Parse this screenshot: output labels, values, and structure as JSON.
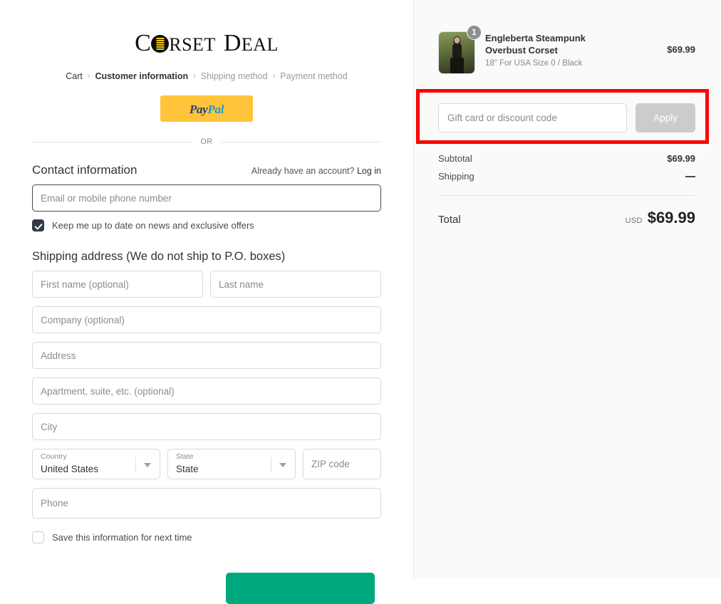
{
  "brand": {
    "logo_text_1": "C",
    "logo_o": "corset-lacing-o",
    "logo_text_2": "RSET",
    "logo_text_3": "D",
    "logo_text_4": "EAL",
    "logo_full": "CORSET DEAL"
  },
  "breadcrumb": {
    "items": [
      {
        "label": "Cart",
        "state": "link"
      },
      {
        "label": "Customer information",
        "state": "active"
      },
      {
        "label": "Shipping method",
        "state": "muted"
      },
      {
        "label": "Payment method",
        "state": "muted"
      }
    ],
    "separator": "›"
  },
  "express": {
    "paypal_pay": "Pay",
    "paypal_pal": "Pal",
    "divider_label": "OR"
  },
  "contact": {
    "title": "Contact information",
    "account_note": "Already have an account?",
    "login_label": "Log in",
    "email_placeholder": "Email or mobile phone number",
    "email_value": "",
    "newsletter_label": "Keep me up to date on news and exclusive offers",
    "newsletter_checked": true
  },
  "shipping_address": {
    "title": "Shipping address (We do not ship to P.O. boxes)",
    "first_name_placeholder": "First name (optional)",
    "first_name_value": "",
    "last_name_placeholder": "Last name",
    "last_name_value": "",
    "company_placeholder": "Company (optional)",
    "company_value": "",
    "address_placeholder": "Address",
    "address_value": "",
    "apartment_placeholder": "Apartment, suite, etc. (optional)",
    "apartment_value": "",
    "city_placeholder": "City",
    "city_value": "",
    "country_label": "Country",
    "country_value": "United States",
    "state_label": "State",
    "state_value": "State",
    "zip_placeholder": "ZIP code",
    "zip_value": "",
    "phone_placeholder": "Phone",
    "phone_value": "",
    "save_info_label": "Save this information for next time",
    "save_info_checked": false
  },
  "summary": {
    "item": {
      "title": "Engleberta Steampunk Overbust Corset",
      "variant": "18\" For USA Size 0 / Black",
      "quantity": "1",
      "price": "$69.99"
    },
    "discount_placeholder": "Gift card or discount code",
    "discount_value": "",
    "apply_label": "Apply",
    "rows": [
      {
        "label": "Subtotal",
        "value": "$69.99"
      },
      {
        "label": "Shipping",
        "value": "—"
      }
    ],
    "total_label": "Total",
    "total_currency": "USD",
    "total_amount": "$69.99"
  },
  "colors": {
    "annotation": "#ff0000",
    "paypal_yellow": "#ffc439",
    "continue_green": "#00a87e",
    "sidebar_bg": "#fafafa"
  }
}
